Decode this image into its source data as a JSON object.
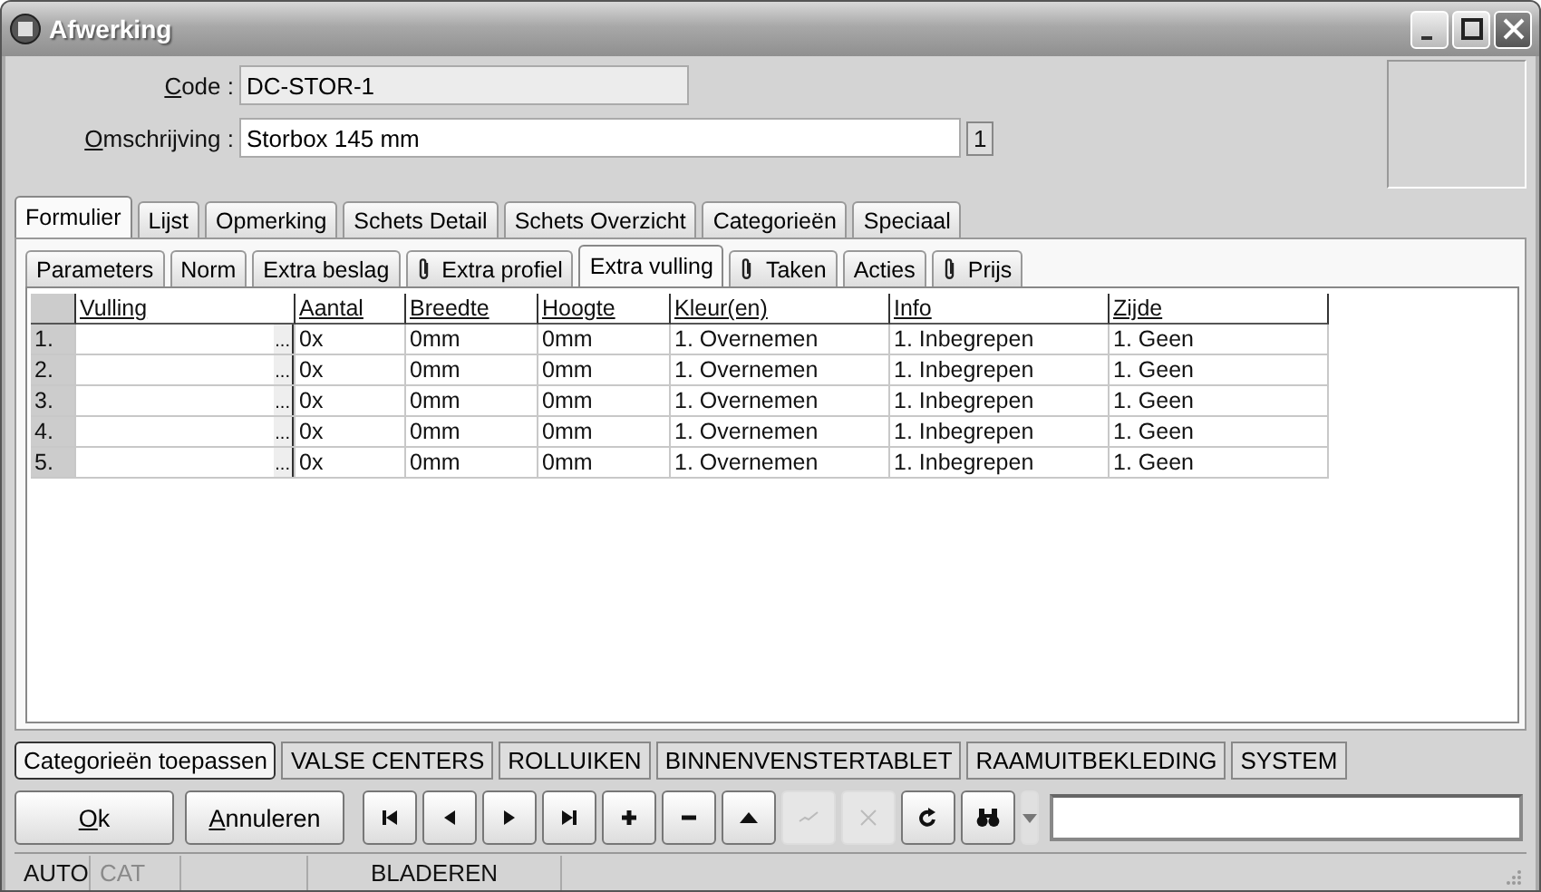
{
  "window": {
    "title": "Afwerking"
  },
  "form": {
    "code_label": "Code :",
    "code_value": "DC-STOR-1",
    "description_label": "Omschrijving :",
    "description_value": "Storbox 145 mm",
    "description_count": "1"
  },
  "tabs": [
    {
      "label": "Formulier",
      "selected": true
    },
    {
      "label": "Lijst",
      "selected": false
    },
    {
      "label": "Opmerking",
      "selected": false
    },
    {
      "label": "Schets Detail",
      "selected": false
    },
    {
      "label": "Schets Overzicht",
      "selected": false
    },
    {
      "label": "Categorieën",
      "selected": false
    },
    {
      "label": "Speciaal",
      "selected": false
    }
  ],
  "subtabs": [
    {
      "label": "Parameters",
      "selected": false,
      "attachment": false
    },
    {
      "label": "Norm",
      "selected": false,
      "attachment": false
    },
    {
      "label": "Extra beslag",
      "selected": false,
      "attachment": false
    },
    {
      "label": "Extra profiel",
      "selected": false,
      "attachment": true
    },
    {
      "label": "Extra vulling",
      "selected": true,
      "attachment": false
    },
    {
      "label": "Taken",
      "selected": false,
      "attachment": true
    },
    {
      "label": "Acties",
      "selected": false,
      "attachment": false
    },
    {
      "label": "Prijs",
      "selected": false,
      "attachment": true
    }
  ],
  "table": {
    "columns": [
      "Vulling",
      "Aantal",
      "Breedte",
      "Hoogte",
      "Kleur(en)",
      "Info",
      "Zijde"
    ],
    "rows": [
      {
        "number": "1.",
        "picker": "...",
        "aantal": "0x",
        "breedte": "0mm",
        "hoogte": "0mm",
        "kleur": "1. Overnemen",
        "info": "1. Inbegrepen",
        "zijde": "1. Geen"
      },
      {
        "number": "2.",
        "picker": "...",
        "aantal": "0x",
        "breedte": "0mm",
        "hoogte": "0mm",
        "kleur": "1. Overnemen",
        "info": "1. Inbegrepen",
        "zijde": "1. Geen"
      },
      {
        "number": "3.",
        "picker": "...",
        "aantal": "0x",
        "breedte": "0mm",
        "hoogte": "0mm",
        "kleur": "1. Overnemen",
        "info": "1. Inbegrepen",
        "zijde": "1. Geen"
      },
      {
        "number": "4.",
        "picker": "...",
        "aantal": "0x",
        "breedte": "0mm",
        "hoogte": "0mm",
        "kleur": "1. Overnemen",
        "info": "1. Inbegrepen",
        "zijde": "1. Geen"
      },
      {
        "number": "5.",
        "picker": "...",
        "aantal": "0x",
        "breedte": "0mm",
        "hoogte": "0mm",
        "kleur": "1. Overnemen",
        "info": "1. Inbegrepen",
        "zijde": "1. Geen"
      }
    ]
  },
  "category_buttons": [
    {
      "label": "Categorieën toepassen",
      "selected": true
    },
    {
      "label": "VALSE CENTERS",
      "selected": false
    },
    {
      "label": "ROLLUIKEN",
      "selected": false
    },
    {
      "label": "BINNENVENSTERTABLET",
      "selected": false
    },
    {
      "label": "RAAMUITBEKLEDING",
      "selected": false
    },
    {
      "label": "SYSTEM",
      "selected": false
    }
  ],
  "buttons": [
    {
      "label": "Ok"
    },
    {
      "label": "Annuleren"
    }
  ],
  "toolbar": [
    {
      "kind": "first",
      "disabled": false
    },
    {
      "kind": "prev",
      "disabled": false
    },
    {
      "kind": "next",
      "disabled": false
    },
    {
      "kind": "last",
      "disabled": false
    },
    {
      "kind": "add",
      "disabled": false
    },
    {
      "kind": "remove",
      "disabled": false
    },
    {
      "kind": "up",
      "disabled": false
    },
    {
      "kind": "confirm",
      "disabled": true
    },
    {
      "kind": "cancel",
      "disabled": true
    },
    {
      "kind": "refresh",
      "disabled": false
    },
    {
      "kind": "find",
      "disabled": false
    },
    {
      "kind": "dropdown",
      "disabled": false
    }
  ],
  "status_bar": [
    {
      "text": "AUTO",
      "disabled": false
    },
    {
      "text": "CAT",
      "disabled": true
    },
    {
      "text": "BLADEREN",
      "disabled": false
    }
  ]
}
